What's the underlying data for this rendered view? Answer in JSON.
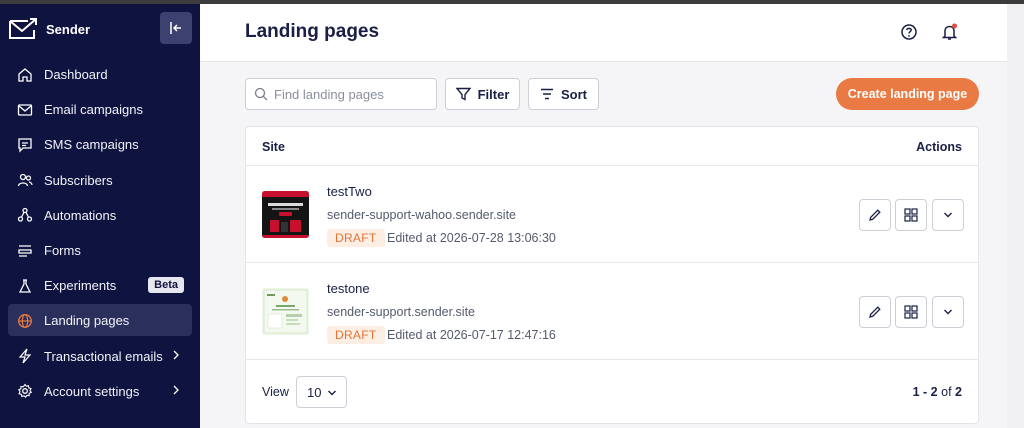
{
  "app": {
    "name": "Sender"
  },
  "sidebar": {
    "items": [
      {
        "label": "Dashboard",
        "icon": "home-icon"
      },
      {
        "label": "Email campaigns",
        "icon": "envelope-icon"
      },
      {
        "label": "SMS campaigns",
        "icon": "chat-bubble-icon"
      },
      {
        "label": "Subscribers",
        "icon": "users-icon"
      },
      {
        "label": "Automations",
        "icon": "workflow-icon"
      },
      {
        "label": "Forms",
        "icon": "form-icon"
      },
      {
        "label": "Experiments",
        "icon": "flask-icon",
        "badge": "Beta"
      },
      {
        "label": "Landing pages",
        "icon": "globe-icon",
        "active": true
      },
      {
        "label": "Transactional emails",
        "icon": "lightning-icon",
        "has_submenu": true
      },
      {
        "label": "Account settings",
        "icon": "gear-icon",
        "has_submenu": true
      }
    ]
  },
  "header": {
    "title": "Landing pages"
  },
  "toolbar": {
    "search_placeholder": "Find landing pages",
    "filter_label": "Filter",
    "sort_label": "Sort",
    "create_label": "Create landing page"
  },
  "table": {
    "headers": {
      "site": "Site",
      "actions": "Actions"
    },
    "rows": [
      {
        "name": "testTwo",
        "domain": "sender-support-wahoo.sender.site",
        "status": "DRAFT",
        "edited": "Edited at 2026-07-28 13:06:30"
      },
      {
        "name": "testone",
        "domain": "sender-support.sender.site",
        "status": "DRAFT",
        "edited": "Edited at 2026-07-17 12:47:16"
      }
    ]
  },
  "footer": {
    "view_label": "View",
    "page_size": "10",
    "range": "1 - 2",
    "of_label": "of",
    "total": "2"
  },
  "colors": {
    "sidebar_bg": "#0f1340",
    "accent": "#e97a43",
    "draft_text": "#e37435",
    "draft_bg": "#fdeee4"
  }
}
